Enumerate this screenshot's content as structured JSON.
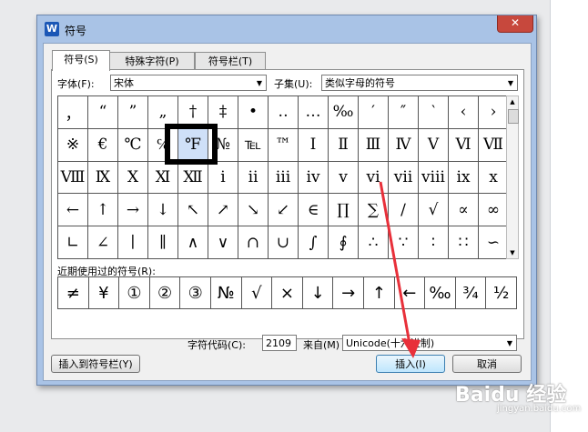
{
  "window": {
    "title": "符号",
    "app_icon": "W",
    "close_glyph": "✕"
  },
  "tabs": [
    {
      "label": "符号(S)",
      "active": true
    },
    {
      "label": "特殊字符(P)",
      "active": false
    },
    {
      "label": "符号栏(T)",
      "active": false
    }
  ],
  "font": {
    "label": "字体(F):",
    "value": "宋体"
  },
  "subset": {
    "label": "子集(U):",
    "value": "类似字母的符号"
  },
  "symbol_grid": [
    [
      "，",
      "“",
      "”",
      "„",
      "†",
      "‡",
      "•",
      "‥",
      "…",
      "‰",
      "′",
      "″",
      "‵",
      "‹",
      "›"
    ],
    [
      "※",
      "€",
      "℃",
      "℅",
      "℉",
      "№",
      "℡",
      "™",
      "Ⅰ",
      "Ⅱ",
      "Ⅲ",
      "Ⅳ",
      "Ⅴ",
      "Ⅵ",
      "Ⅶ"
    ],
    [
      "Ⅷ",
      "Ⅸ",
      "Ⅹ",
      "Ⅺ",
      "Ⅻ",
      "ⅰ",
      "ⅱ",
      "ⅲ",
      "ⅳ",
      "ⅴ",
      "ⅵ",
      "ⅶ",
      "ⅷ",
      "ⅸ",
      "ⅹ"
    ],
    [
      "←",
      "↑",
      "→",
      "↓",
      "↖",
      "↗",
      "↘",
      "↙",
      "∈",
      "∏",
      "∑",
      "∕",
      "√",
      "∝",
      "∞"
    ],
    [
      "∟",
      "∠",
      "∣",
      "∥",
      "∧",
      "∨",
      "∩",
      "∪",
      "∫",
      "∮",
      "∴",
      "∵",
      "∶",
      "∷",
      "∽"
    ]
  ],
  "selected_symbol": "℉",
  "recent": {
    "label": "近期使用过的符号(R):",
    "symbols": [
      "≠",
      "¥",
      "①",
      "②",
      "③",
      "№",
      "√",
      "×",
      "↓",
      "→",
      "↑",
      "←",
      "‰",
      "¾",
      "½"
    ]
  },
  "char_code": {
    "label": "字符代码(C):",
    "value": "2109"
  },
  "from": {
    "label": "来自(M)",
    "value": "Unicode(十六进制)"
  },
  "buttons": {
    "insert_to_bar": "插入到符号栏(Y)",
    "insert": "插入(I)",
    "cancel": "取消"
  },
  "icons": {
    "dropdown": "chevron-down-icon",
    "close": "close-icon"
  },
  "colors": {
    "accent_arrow": "#e8303a",
    "selection": "#cfe0f8",
    "frame": "#a9c3e6"
  },
  "watermark": {
    "brand": "Baidu 经验",
    "sub": "jingyan.baidu.com"
  }
}
